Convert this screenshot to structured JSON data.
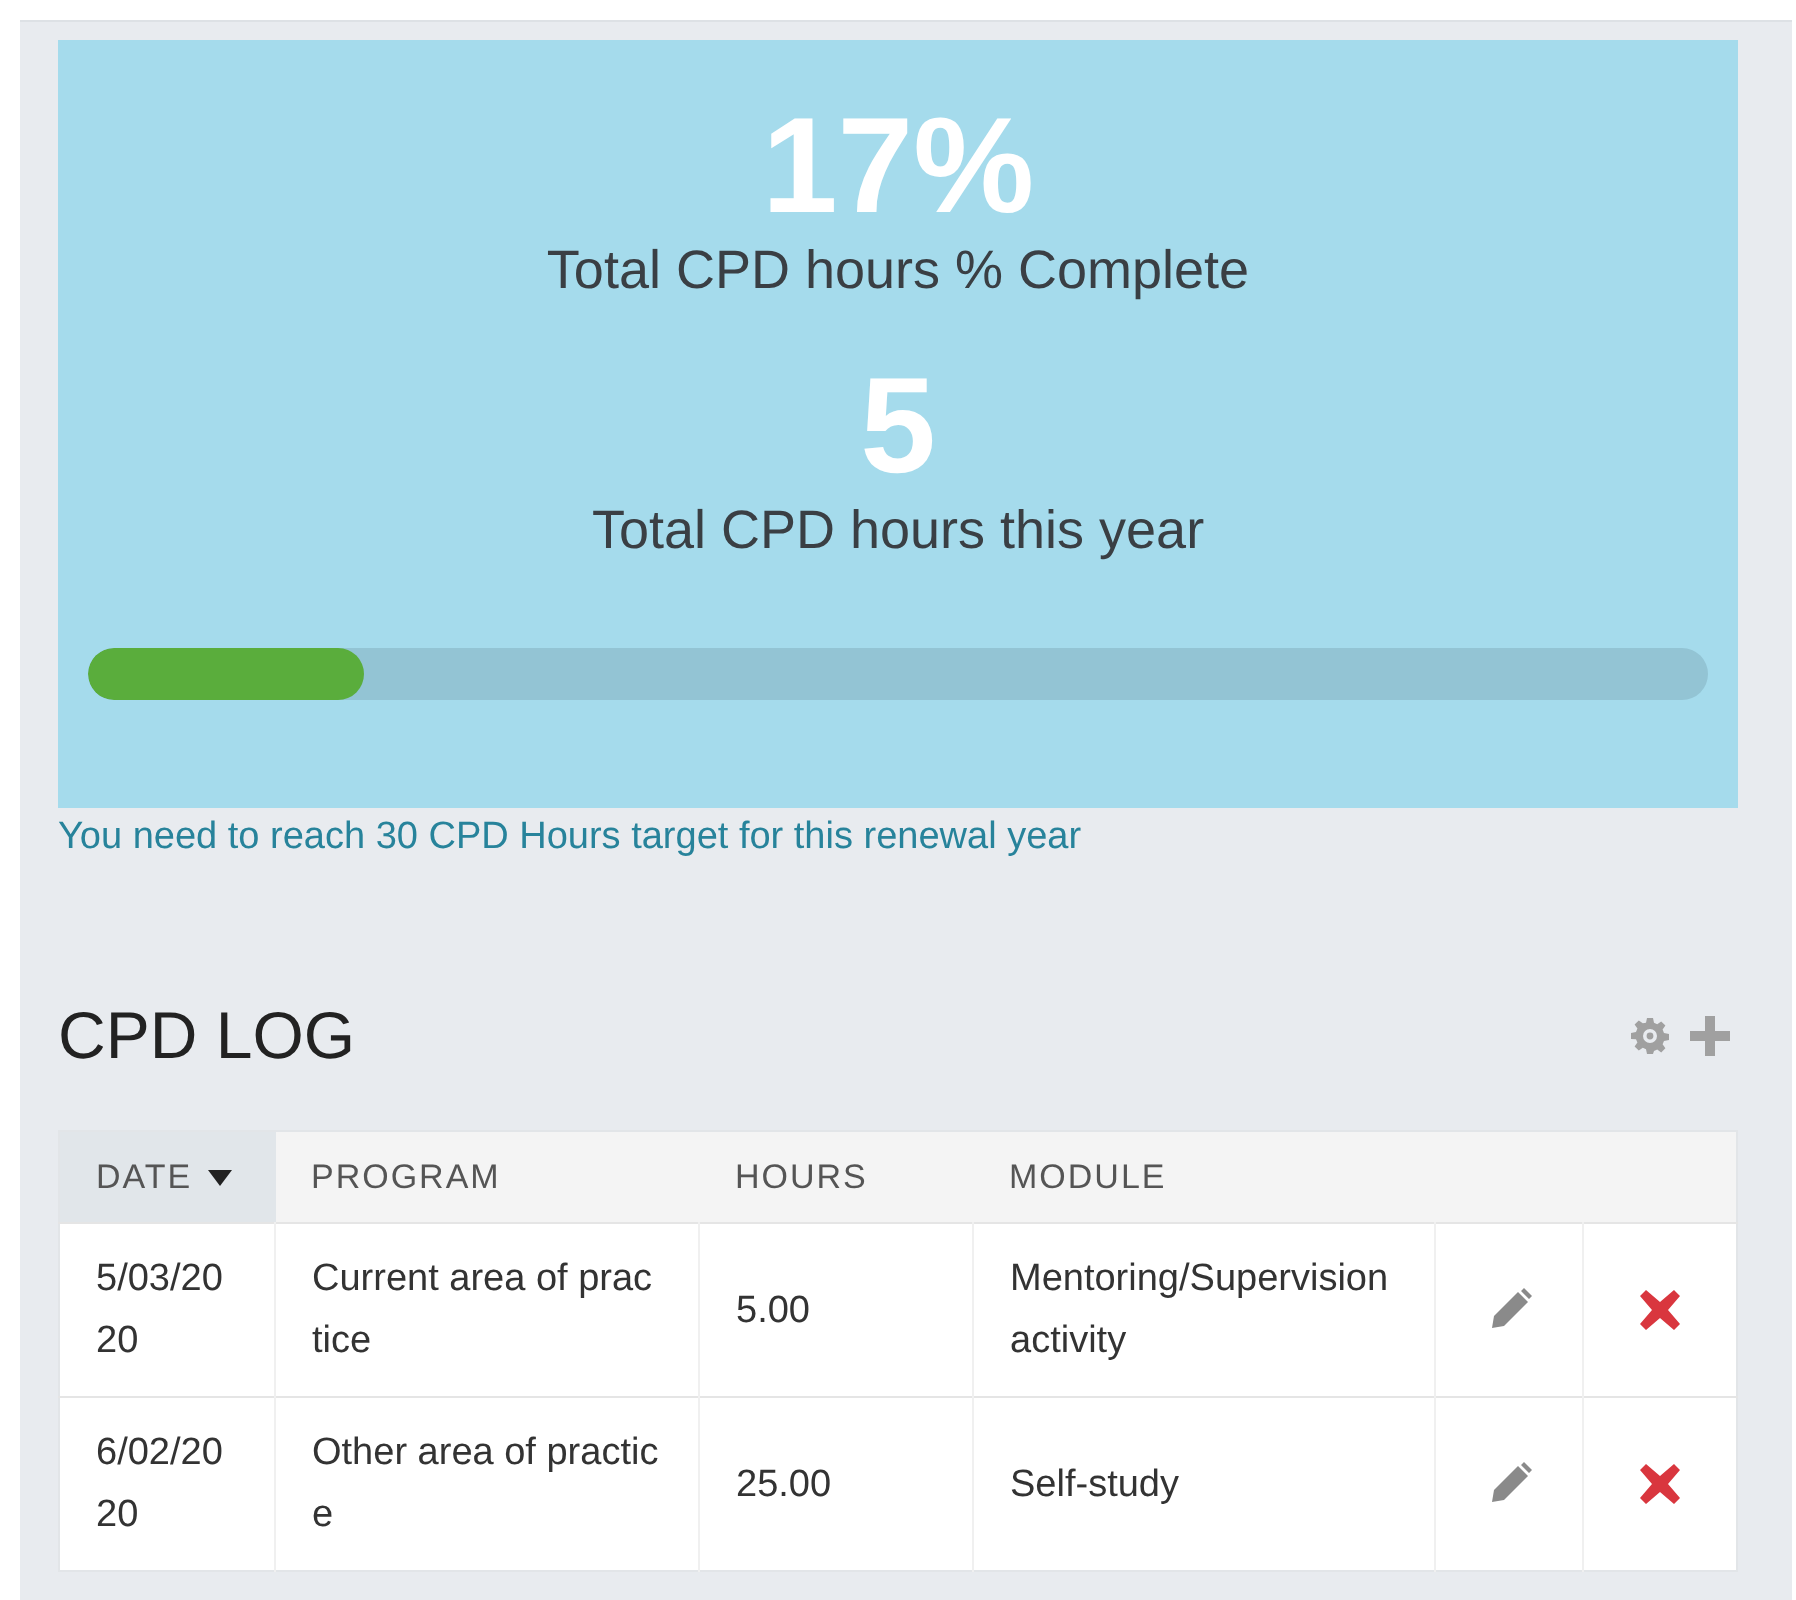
{
  "summary": {
    "percent": "17%",
    "percent_label": "Total CPD hours % Complete",
    "hours": "5",
    "hours_label": "Total CPD hours this year",
    "progress": {
      "level": 0.17
    },
    "target_note": "You need to reach 30 CPD Hours target for this renewal year"
  },
  "log": {
    "title": "CPD LOG",
    "columns": [
      {
        "label": "DATE",
        "sorted": true
      },
      {
        "label": "PROGRAM",
        "sorted": false
      },
      {
        "label": "HOURS",
        "sorted": false
      },
      {
        "label": "MODULE",
        "sorted": false
      }
    ],
    "rows": [
      {
        "date": "5/03/2020",
        "program": "Current area of practice",
        "hours": "5.00",
        "module": "Mentoring/Supervision activity"
      },
      {
        "date": "6/02/2020",
        "program": "Other area of practice",
        "hours": "25.00",
        "module": "Self-study"
      }
    ]
  }
}
